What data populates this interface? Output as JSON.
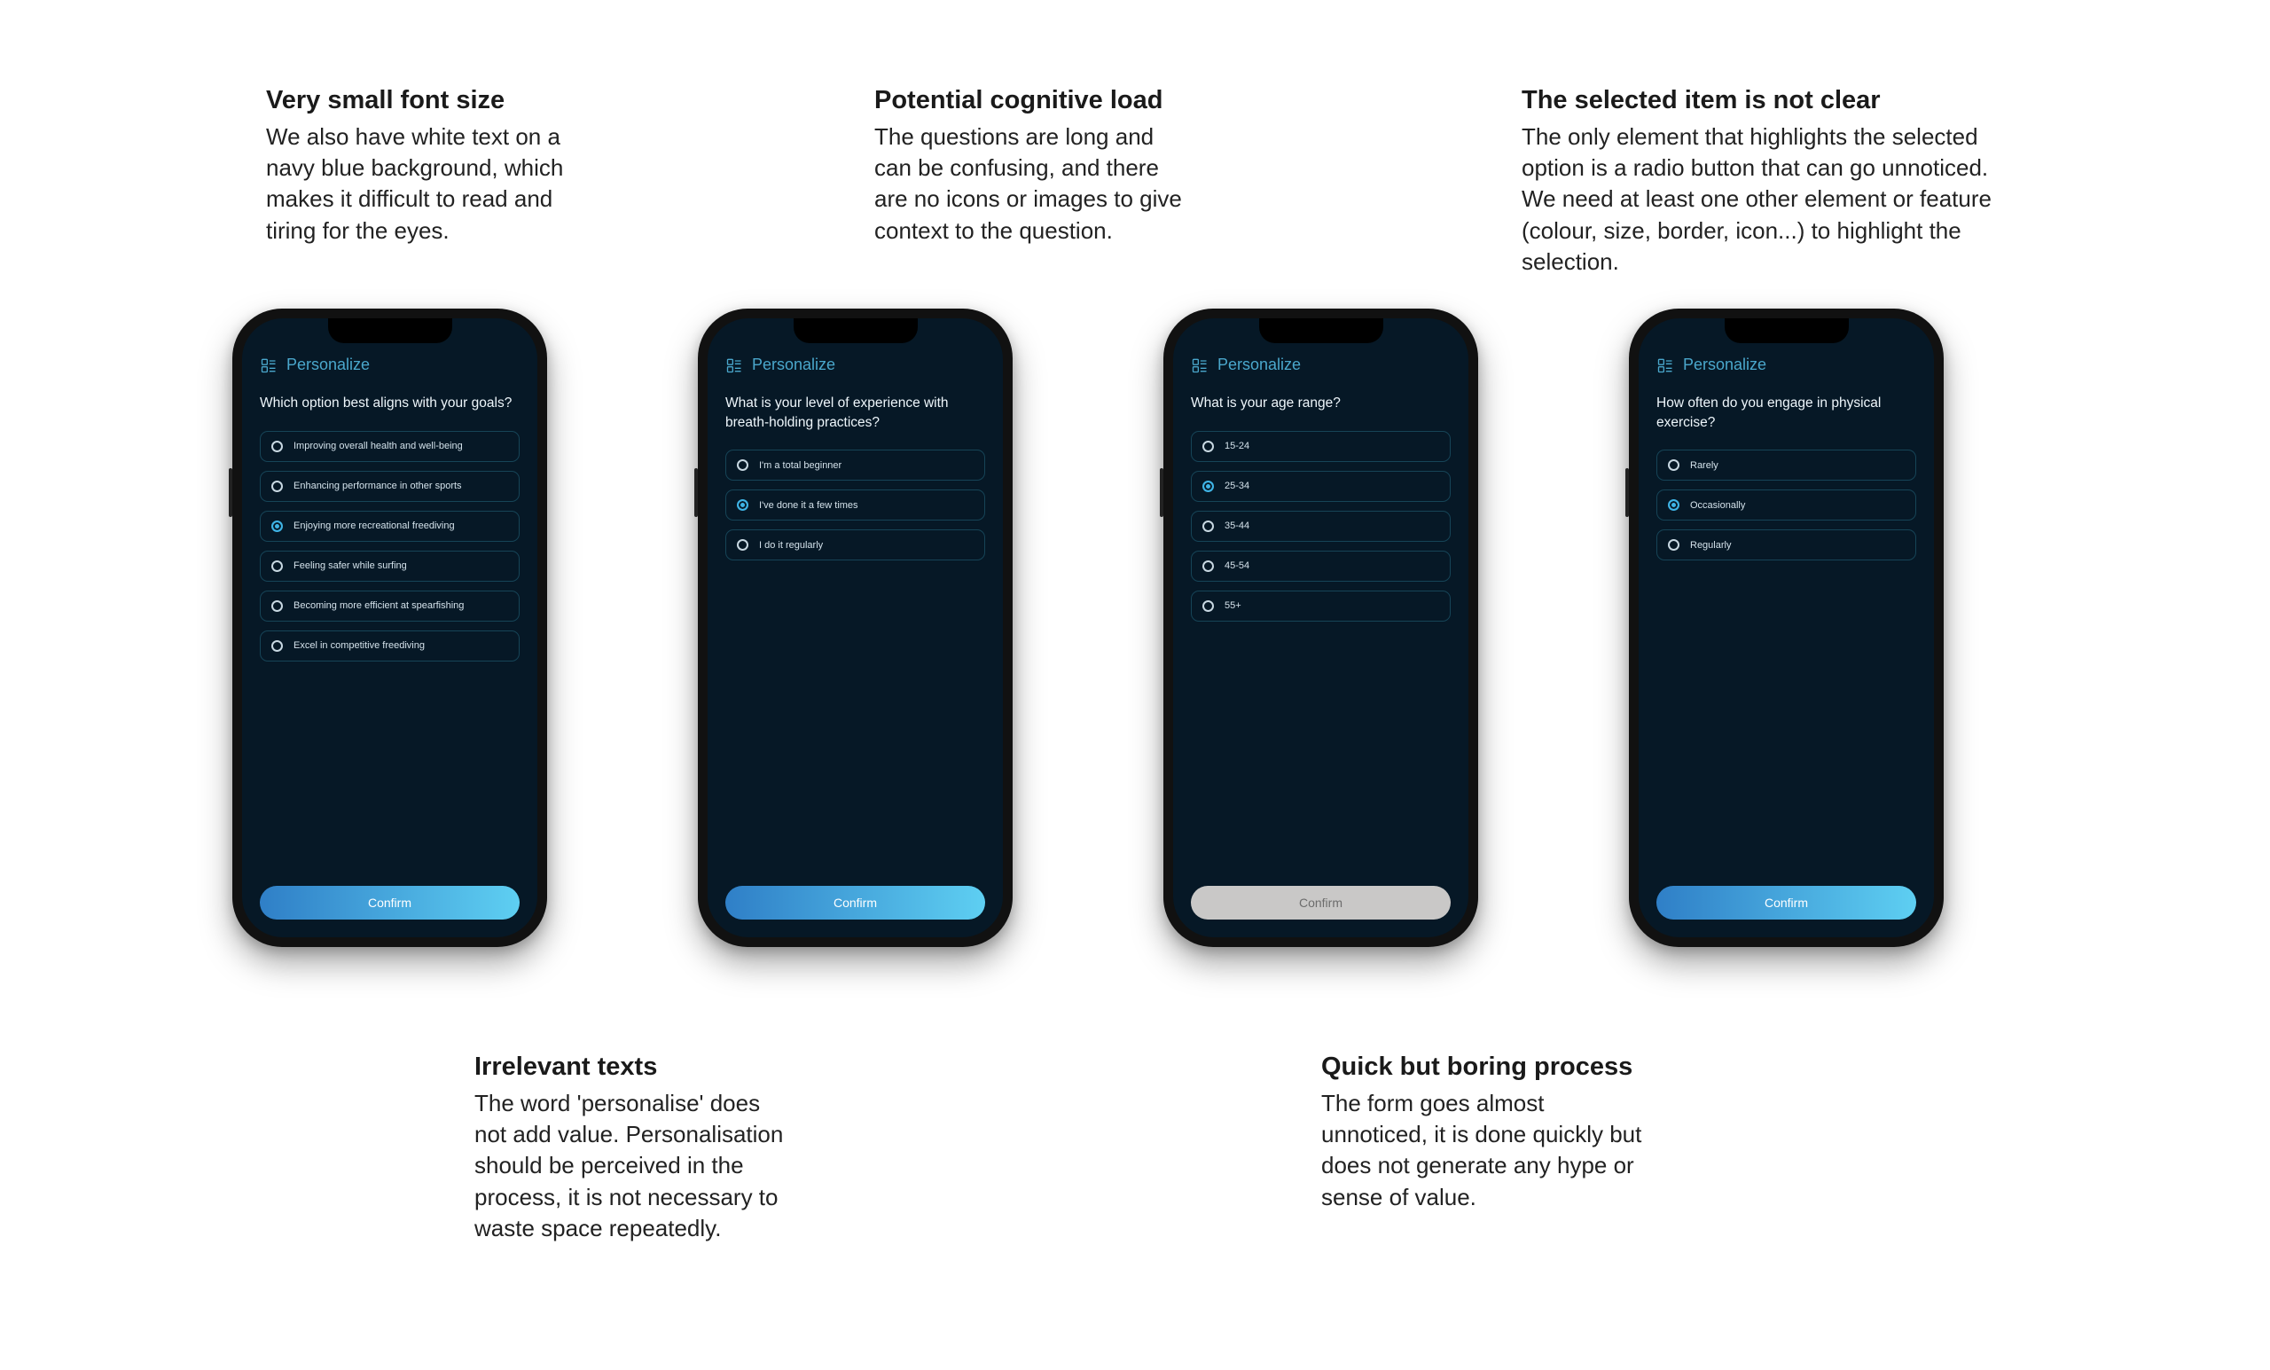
{
  "annotations": {
    "a1": {
      "title": "Very small font size",
      "body": "We also have white text on a navy blue background, which makes it difficult to read and tiring for the eyes."
    },
    "a2": {
      "title": "Potential cognitive load",
      "body": "The questions are long and can be confusing, and there are no icons or images to give context to the question."
    },
    "a3": {
      "title": "The selected item is not clear",
      "body": "The only element that highlights the selected option is a radio button that can go unnoticed. We need at least one other element or feature (colour, size, border, icon...) to highlight the selection."
    },
    "a4": {
      "title": "Irrelevant texts",
      "body": "The word 'personalise' does not add value. Personalisation should be perceived in the process, it is not necessary to waste space repeatedly."
    },
    "a5": {
      "title": "Quick but boring process",
      "body": "The form goes almost unnoticed, it is done quickly but does not generate any hype or sense of value."
    }
  },
  "common": {
    "header_title": "Personalize",
    "header_icon": "personalize-list-icon",
    "confirm_label": "Confirm"
  },
  "phones": [
    {
      "question": "Which option best aligns with your goals?",
      "confirm_state": "active",
      "options": [
        {
          "label": "Improving overall health and well-being",
          "selected": false
        },
        {
          "label": "Enhancing performance in other sports",
          "selected": false
        },
        {
          "label": "Enjoying more recreational freediving",
          "selected": true
        },
        {
          "label": "Feeling safer while surfing",
          "selected": false
        },
        {
          "label": "Becoming more efficient at spearfishing",
          "selected": false
        },
        {
          "label": "Excel in competitive freediving",
          "selected": false
        }
      ]
    },
    {
      "question": "What is your level of experience with breath-holding practices?",
      "confirm_state": "active",
      "options": [
        {
          "label": "I'm a total beginner",
          "selected": false
        },
        {
          "label": "I've done it a few times",
          "selected": true
        },
        {
          "label": "I do it regularly",
          "selected": false
        }
      ]
    },
    {
      "question": "What is your age range?",
      "confirm_state": "disabled",
      "options": [
        {
          "label": "15-24",
          "selected": false
        },
        {
          "label": "25-34",
          "selected": true
        },
        {
          "label": "35-44",
          "selected": false
        },
        {
          "label": "45-54",
          "selected": false
        },
        {
          "label": "55+",
          "selected": false
        }
      ]
    },
    {
      "question": "How often do you engage in physical exercise?",
      "confirm_state": "active",
      "options": [
        {
          "label": "Rarely",
          "selected": false
        },
        {
          "label": "Occasionally",
          "selected": true
        },
        {
          "label": "Regularly",
          "selected": false
        }
      ]
    }
  ]
}
